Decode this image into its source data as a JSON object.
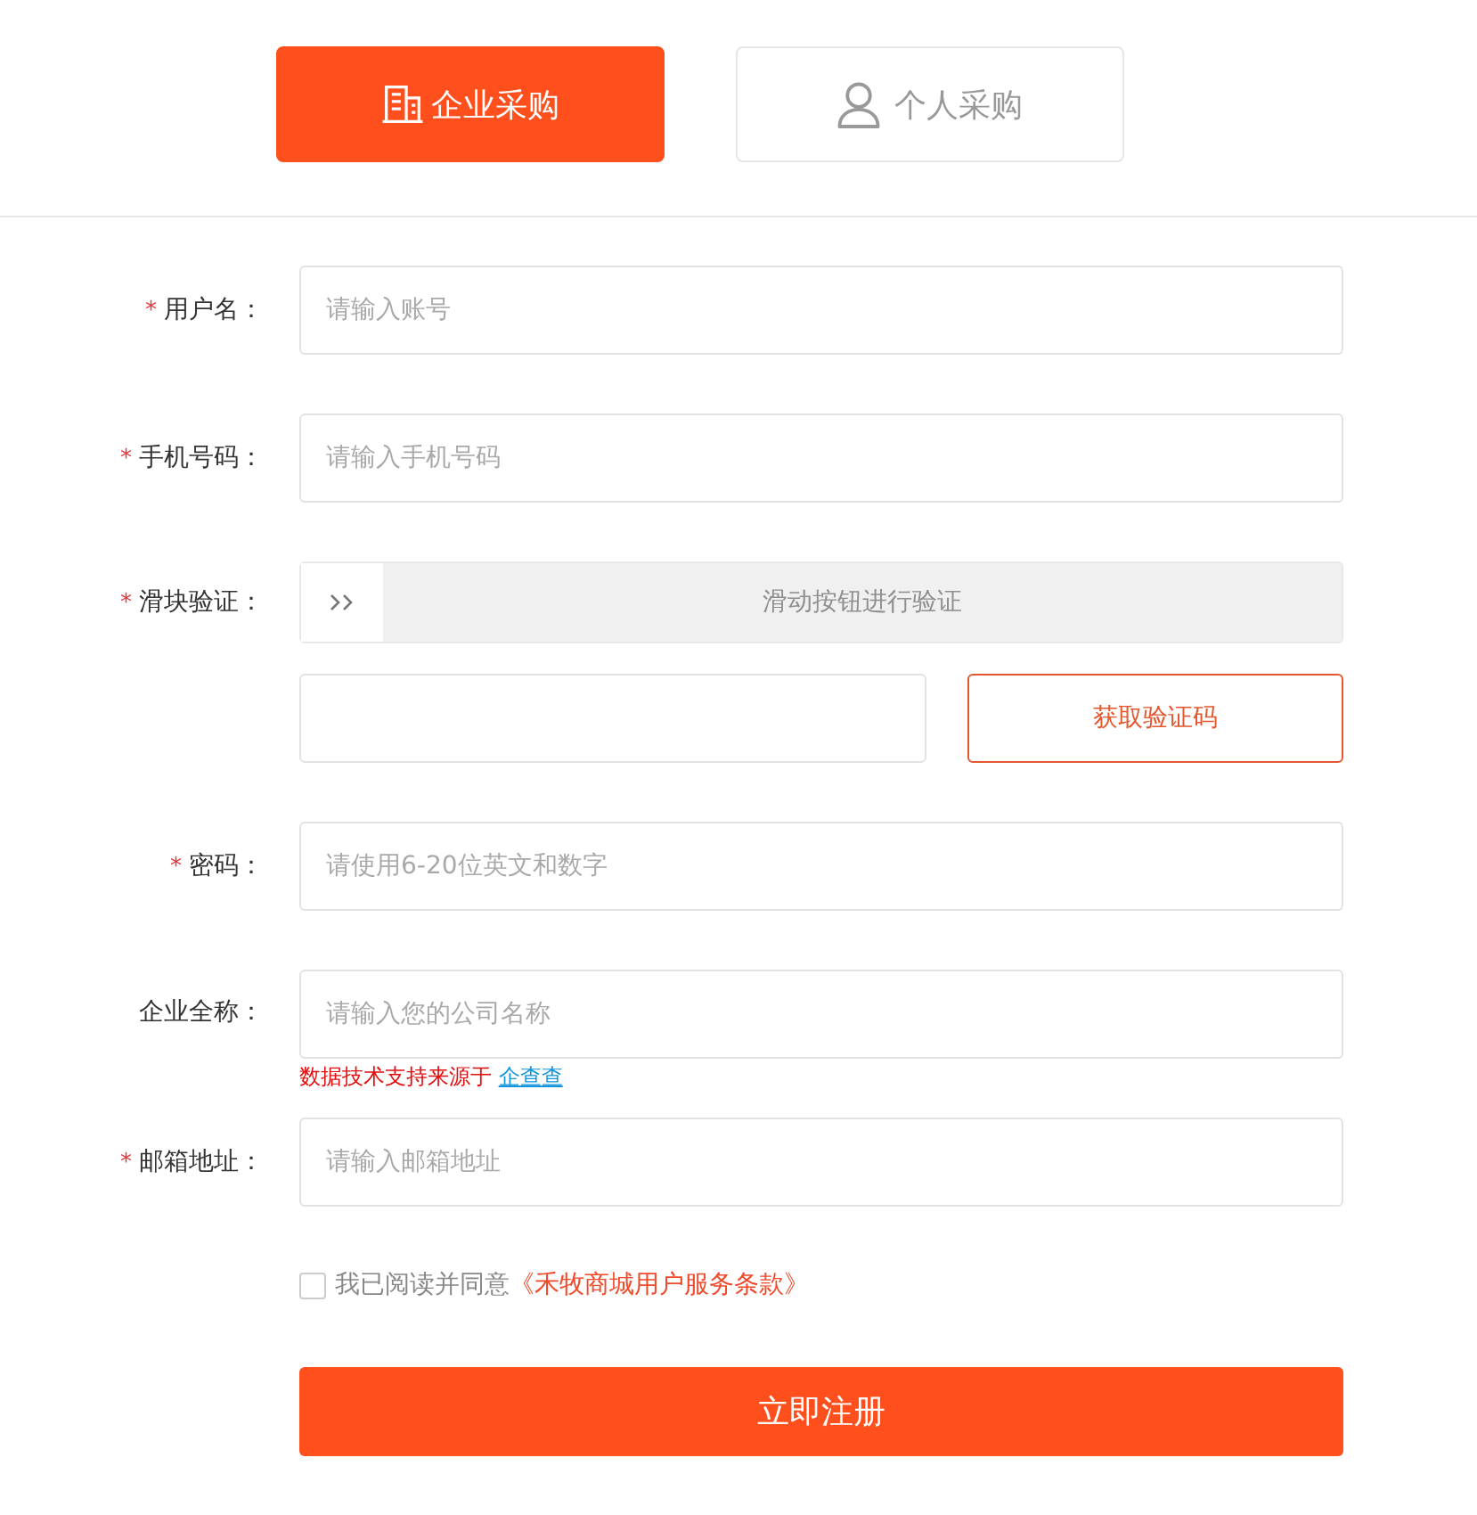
{
  "tabs": [
    {
      "kind": "enterprise",
      "label": "企业采购",
      "selected": true
    },
    {
      "kind": "personal",
      "label": "个人采购",
      "selected": false
    }
  ],
  "form": {
    "rows": [
      {
        "kind": "input",
        "required_mark": "*",
        "label": "用户名：",
        "placeholder": "请输入账号"
      },
      {
        "kind": "input",
        "required_mark": "*",
        "label": "手机号码：",
        "placeholder": "请输入手机号码"
      },
      {
        "kind": "slider",
        "required_mark": "*",
        "label": "滑块验证：",
        "hint": "滑动按钮进行验证",
        "level": 0
      },
      {
        "kind": "code",
        "button": "获取验证码"
      },
      {
        "kind": "input",
        "required_mark": "*",
        "label": "密码：",
        "placeholder": "请使用6-20位英文和数字"
      },
      {
        "kind": "input",
        "label": "企业全称：",
        "placeholder": "请输入您的公司名称",
        "note": "数据技术支持来源于",
        "note_link": "企查查"
      },
      {
        "kind": "input",
        "required_mark": "*",
        "label": "邮箱地址：",
        "placeholder": "请输入邮箱地址"
      }
    ],
    "agreement": {
      "checked": false,
      "text": "我已阅读并同意",
      "link": "《禾牧商城用户服务条款》"
    },
    "submit": "立即注册"
  }
}
